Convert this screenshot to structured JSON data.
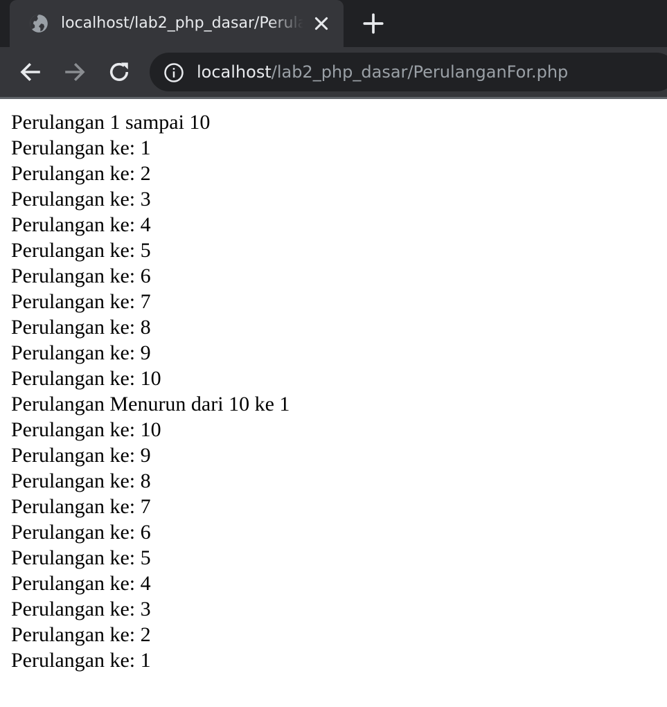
{
  "browser": {
    "tab": {
      "title": "localhost/lab2_php_dasar/PerulanganFor.php",
      "favicon": "globe-icon",
      "close_icon": "close-icon"
    },
    "new_tab_icon": "plus-icon",
    "toolbar": {
      "back_icon": "back-arrow-icon",
      "forward_icon": "forward-arrow-icon",
      "reload_icon": "reload-icon",
      "site_info_icon": "info-icon"
    },
    "address": {
      "host": "localhost",
      "path": "/lab2_php_dasar/PerulanganFor.php"
    },
    "colors": {
      "tabstrip_bg": "#202124",
      "tab_bg": "#35363a",
      "omnibox_bg": "#202124",
      "text_primary": "#e8eaed",
      "text_secondary": "#9aa0a6"
    }
  },
  "page": {
    "lines": [
      "Perulangan 1 sampai 10",
      "Perulangan ke: 1",
      "Perulangan ke: 2",
      "Perulangan ke: 3",
      "Perulangan ke: 4",
      "Perulangan ke: 5",
      "Perulangan ke: 6",
      "Perulangan ke: 7",
      "Perulangan ke: 8",
      "Perulangan ke: 9",
      "Perulangan ke: 10",
      "Perulangan Menurun dari 10 ke 1",
      "Perulangan ke: 10",
      "Perulangan ke: 9",
      "Perulangan ke: 8",
      "Perulangan ke: 7",
      "Perulangan ke: 6",
      "Perulangan ke: 5",
      "Perulangan ke: 4",
      "Perulangan ke: 3",
      "Perulangan ke: 2",
      "Perulangan ke: 1"
    ]
  }
}
